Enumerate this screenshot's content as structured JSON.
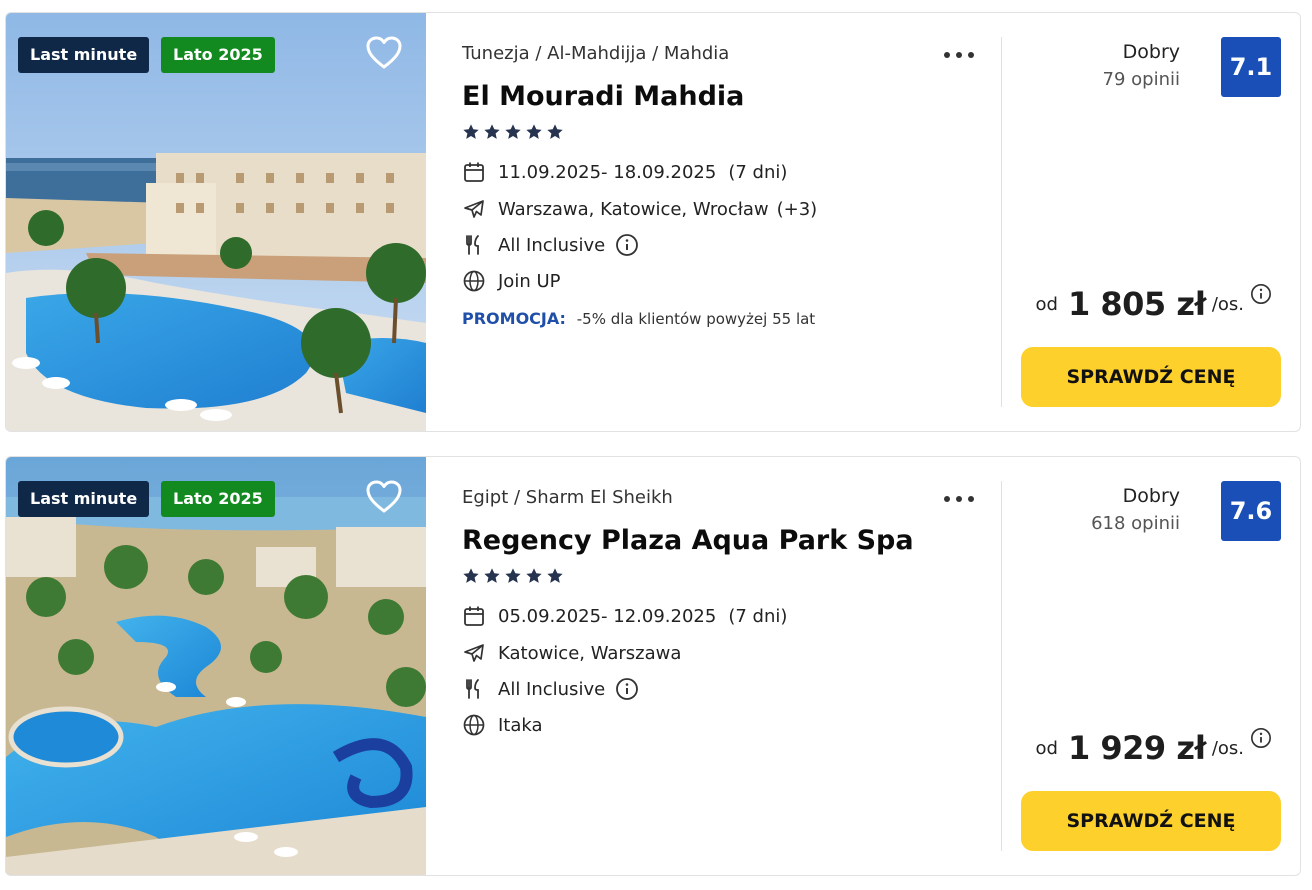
{
  "offers": [
    {
      "badges": [
        "Last minute",
        "Lato 2025"
      ],
      "location": "Tunezja / Al-Mahdijja / Mahdia",
      "name": "El Mouradi Mahdia",
      "stars": 5,
      "dates": "11.09.2025- 18.09.2025",
      "duration": "(7 dni)",
      "departures": "Warszawa, Katowice, Wrocław",
      "departures_more": "(+3)",
      "board": "All Inclusive",
      "operator": "Join UP",
      "promo_label": "PROMOCJA:",
      "promo_text": "-5% dla klientów powyżej 55 lat",
      "rating_word": "Dobry",
      "reviews": "79 opinii",
      "score": "7.1",
      "price_prefix": "od",
      "price": "1 805 zł",
      "price_suffix": "/os.",
      "cta": "SPRAWDŹ CENĘ",
      "image": "hotel-resort-with-pool-and-sea"
    },
    {
      "badges": [
        "Last minute",
        "Lato 2025"
      ],
      "location": "Egipt / Sharm El Sheikh",
      "name": "Regency Plaza Aqua Park Spa",
      "stars": 5,
      "dates": "05.09.2025- 12.09.2025",
      "duration": "(7 dni)",
      "departures": "Katowice, Warszawa",
      "departures_more": "",
      "board": "All Inclusive",
      "operator": "Itaka",
      "rating_word": "Dobry",
      "reviews": "618 opinii",
      "score": "7.6",
      "price_prefix": "od",
      "price": "1 929 zł",
      "price_suffix": "/os.",
      "cta": "SPRAWDŹ CENĘ",
      "image": "aqua-park-pools-aerial"
    }
  ],
  "colors": {
    "badge_last_minute": "#0f2847",
    "badge_season": "#138a1f",
    "score_bg": "#1a4fb8",
    "promo_label": "#1f4fa8",
    "cta_bg": "#fdd02b"
  },
  "icons": {
    "favorite": "heart-outline-icon",
    "more": "more-dots-icon",
    "star": "star-icon",
    "dates": "calendar-icon",
    "departures": "plane-icon",
    "board": "cutlery-icon",
    "operator": "globe-icon",
    "info": "info-circle-icon"
  }
}
